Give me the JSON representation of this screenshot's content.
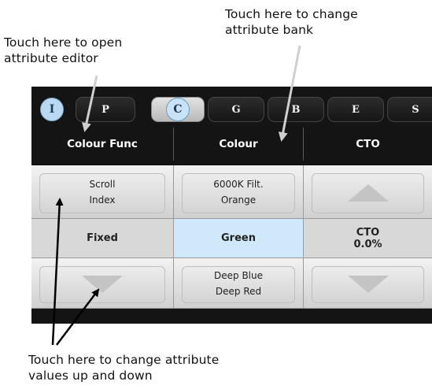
{
  "annotations": {
    "bank": [
      "Touch here to change",
      "attribute bank"
    ],
    "editor": [
      "Touch here to open",
      "attribute editor"
    ],
    "values": [
      "Touch here to change attribute",
      "values up and down"
    ]
  },
  "banks": [
    {
      "label": "I",
      "style": "circle-i"
    },
    {
      "label": "P",
      "style": "plain"
    },
    {
      "label": "C",
      "style": "active"
    },
    {
      "label": "G",
      "style": "plain"
    },
    {
      "label": "B",
      "style": "plain"
    },
    {
      "label": "E",
      "style": "plain"
    },
    {
      "label": "S",
      "style": "plain"
    }
  ],
  "columns": [
    {
      "header": "Colour Func",
      "up": [
        "Scroll",
        "Index"
      ],
      "current": "Fixed",
      "down": []
    },
    {
      "header": "Colour",
      "up": [
        "6000K Filt.",
        "Orange"
      ],
      "current": "Green",
      "down": [
        "Deep Blue",
        "Deep Red"
      ]
    },
    {
      "header": "CTO",
      "up": [],
      "current": [
        "CTO",
        "0.0%"
      ],
      "down": []
    }
  ],
  "colors": {
    "selected": "#cfe9fb",
    "panel": "#141414"
  }
}
